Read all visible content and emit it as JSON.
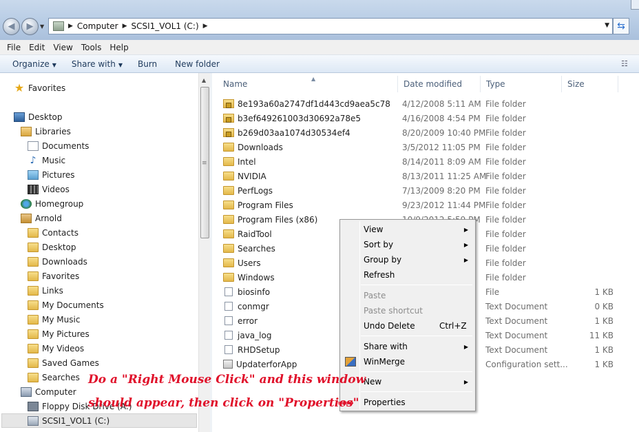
{
  "address_bar": {
    "crumbs": [
      "Computer",
      "SCSI1_VOL1 (C:)"
    ]
  },
  "menu": [
    "File",
    "Edit",
    "View",
    "Tools",
    "Help"
  ],
  "toolbar": {
    "organize": "Organize",
    "share_with": "Share with",
    "burn": "Burn",
    "new_folder": "New folder"
  },
  "nav": {
    "favorites": "Favorites",
    "desktop": "Desktop",
    "libraries": "Libraries",
    "documents": "Documents",
    "music": "Music",
    "pictures": "Pictures",
    "videos": "Videos",
    "homegroup": "Homegroup",
    "arnold": "Arnold",
    "contacts": "Contacts",
    "u_desktop": "Desktop",
    "downloads": "Downloads",
    "u_favorites": "Favorites",
    "links": "Links",
    "my_documents": "My Documents",
    "my_music": "My Music",
    "my_pictures": "My Pictures",
    "my_videos": "My Videos",
    "saved_games": "Saved Games",
    "searches": "Searches",
    "computer": "Computer",
    "floppy": "Floppy Disk Drive (A:)",
    "drive_c": "SCSI1_VOL1 (C:)"
  },
  "columns": {
    "name": "Name",
    "date": "Date modified",
    "type": "Type",
    "size": "Size"
  },
  "files": [
    {
      "name": "8e193a60a2747df1d443cd9aea5c78",
      "date": "4/12/2008 5:11 AM",
      "type": "File folder",
      "size": "",
      "icon": "locked-folder-icon"
    },
    {
      "name": "b3ef649261003d30692a78e5",
      "date": "4/16/2008 4:54 PM",
      "type": "File folder",
      "size": "",
      "icon": "locked-folder-icon"
    },
    {
      "name": "b269d03aa1074d30534ef4",
      "date": "8/20/2009 10:40 PM",
      "type": "File folder",
      "size": "",
      "icon": "locked-folder-icon"
    },
    {
      "name": "Downloads",
      "date": "3/5/2012 11:05 PM",
      "type": "File folder",
      "size": "",
      "icon": "folder-icon"
    },
    {
      "name": "Intel",
      "date": "8/14/2011 8:09 AM",
      "type": "File folder",
      "size": "",
      "icon": "folder-icon"
    },
    {
      "name": "NVIDIA",
      "date": "8/13/2011 11:25 AM",
      "type": "File folder",
      "size": "",
      "icon": "folder-icon"
    },
    {
      "name": "PerfLogs",
      "date": "7/13/2009 8:20 PM",
      "type": "File folder",
      "size": "",
      "icon": "folder-icon"
    },
    {
      "name": "Program Files",
      "date": "9/23/2012 11:44 PM",
      "type": "File folder",
      "size": "",
      "icon": "folder-icon"
    },
    {
      "name": "Program Files (x86)",
      "date": "10/9/2012 5:59 PM",
      "type": "File folder",
      "size": "",
      "icon": "folder-icon"
    },
    {
      "name": "RaidTool",
      "date": "",
      "type": "File folder",
      "size": "",
      "icon": "folder-icon"
    },
    {
      "name": "Searches",
      "date": "",
      "type": "File folder",
      "size": "",
      "icon": "folder-icon"
    },
    {
      "name": "Users",
      "date": "",
      "type": "File folder",
      "size": "",
      "icon": "folder-icon"
    },
    {
      "name": "Windows",
      "date": "",
      "type": "File folder",
      "size": "",
      "icon": "folder-icon"
    },
    {
      "name": "biosinfo",
      "date": "",
      "type": "File",
      "size": "1 KB",
      "icon": "file-icon"
    },
    {
      "name": "conmgr",
      "date": "",
      "type": "Text Document",
      "size": "0 KB",
      "icon": "text-file-icon"
    },
    {
      "name": "error",
      "date": "",
      "type": "Text Document",
      "size": "1 KB",
      "icon": "text-file-icon"
    },
    {
      "name": "java_log",
      "date": "",
      "type": "Text Document",
      "size": "11 KB",
      "icon": "text-file-icon"
    },
    {
      "name": "RHDSetup",
      "date": "",
      "type": "Text Document",
      "size": "1 KB",
      "icon": "text-file-icon"
    },
    {
      "name": "UpdaterforApp",
      "date": "",
      "type": "Configuration sett...",
      "size": "1 KB",
      "icon": "config-file-icon"
    }
  ],
  "context_menu": {
    "view": "View",
    "sort_by": "Sort by",
    "group_by": "Group by",
    "refresh": "Refresh",
    "paste": "Paste",
    "paste_shortcut": "Paste shortcut",
    "undo_delete": "Undo Delete",
    "undo_shortcut": "Ctrl+Z",
    "share_with": "Share with",
    "winmerge": "WinMerge",
    "new": "New",
    "properties": "Properties"
  },
  "annotation": {
    "line1": "Do a \"Right Mouse Click\" and this window",
    "line2": "should appear, then click on \"Properties\""
  }
}
